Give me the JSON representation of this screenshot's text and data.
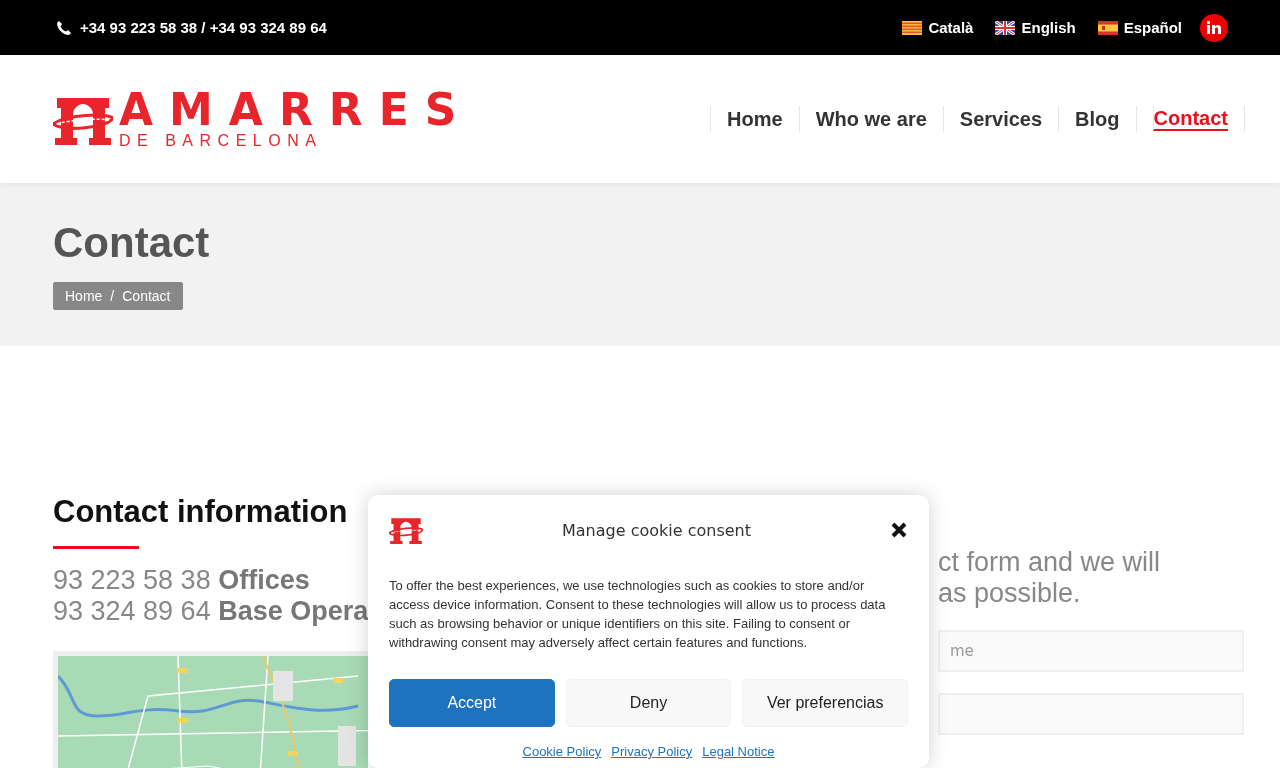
{
  "top_bar": {
    "phone": "+34 93 223 58 38 / +34 93 324 89 64",
    "languages": [
      {
        "label": "Català",
        "kind": "ca"
      },
      {
        "label": "English",
        "kind": "en"
      },
      {
        "label": "Español",
        "kind": "es"
      }
    ]
  },
  "logo": {
    "name": "AMARRES",
    "tagline": "DE BARCELONA"
  },
  "nav": [
    {
      "label": "Home",
      "selected": false
    },
    {
      "label": "Who we are",
      "selected": false
    },
    {
      "label": "Services",
      "selected": false
    },
    {
      "label": "Blog",
      "selected": false
    },
    {
      "label": "Contact",
      "selected": true
    }
  ],
  "page_title": "Contact",
  "breadcrumb": {
    "items": [
      "Home",
      "Contact"
    ],
    "separator": "/"
  },
  "contact": {
    "heading": "Contact information",
    "phones": [
      {
        "number": "93 223 58 38",
        "label": "Offices"
      },
      {
        "number": "93 324 89 64",
        "label": "Base Opera"
      }
    ]
  },
  "form": {
    "intro": [
      "ct form and we will",
      "as possible."
    ],
    "fields": [
      {
        "kind": "text",
        "placeholder": "me"
      },
      {
        "kind": "text"
      }
    ]
  },
  "cookie_dialog": {
    "title": "Manage cookie consent",
    "text": "To offer the best experiences, we use technologies such as cookies to store and/or access device information. Consent to these technologies will allow us to process data such as browsing behavior or unique identifiers on this site. Failing to consent or withdrawing consent may adversely affect certain features and functions.",
    "buttons": [
      {
        "label": "Accept",
        "kind": "primary"
      },
      {
        "label": "Deny",
        "kind": "secondary"
      },
      {
        "label": "Ver preferencias",
        "kind": "secondary"
      }
    ],
    "links": [
      "Cookie Policy",
      "Privacy Policy",
      "Legal Notice"
    ]
  }
}
